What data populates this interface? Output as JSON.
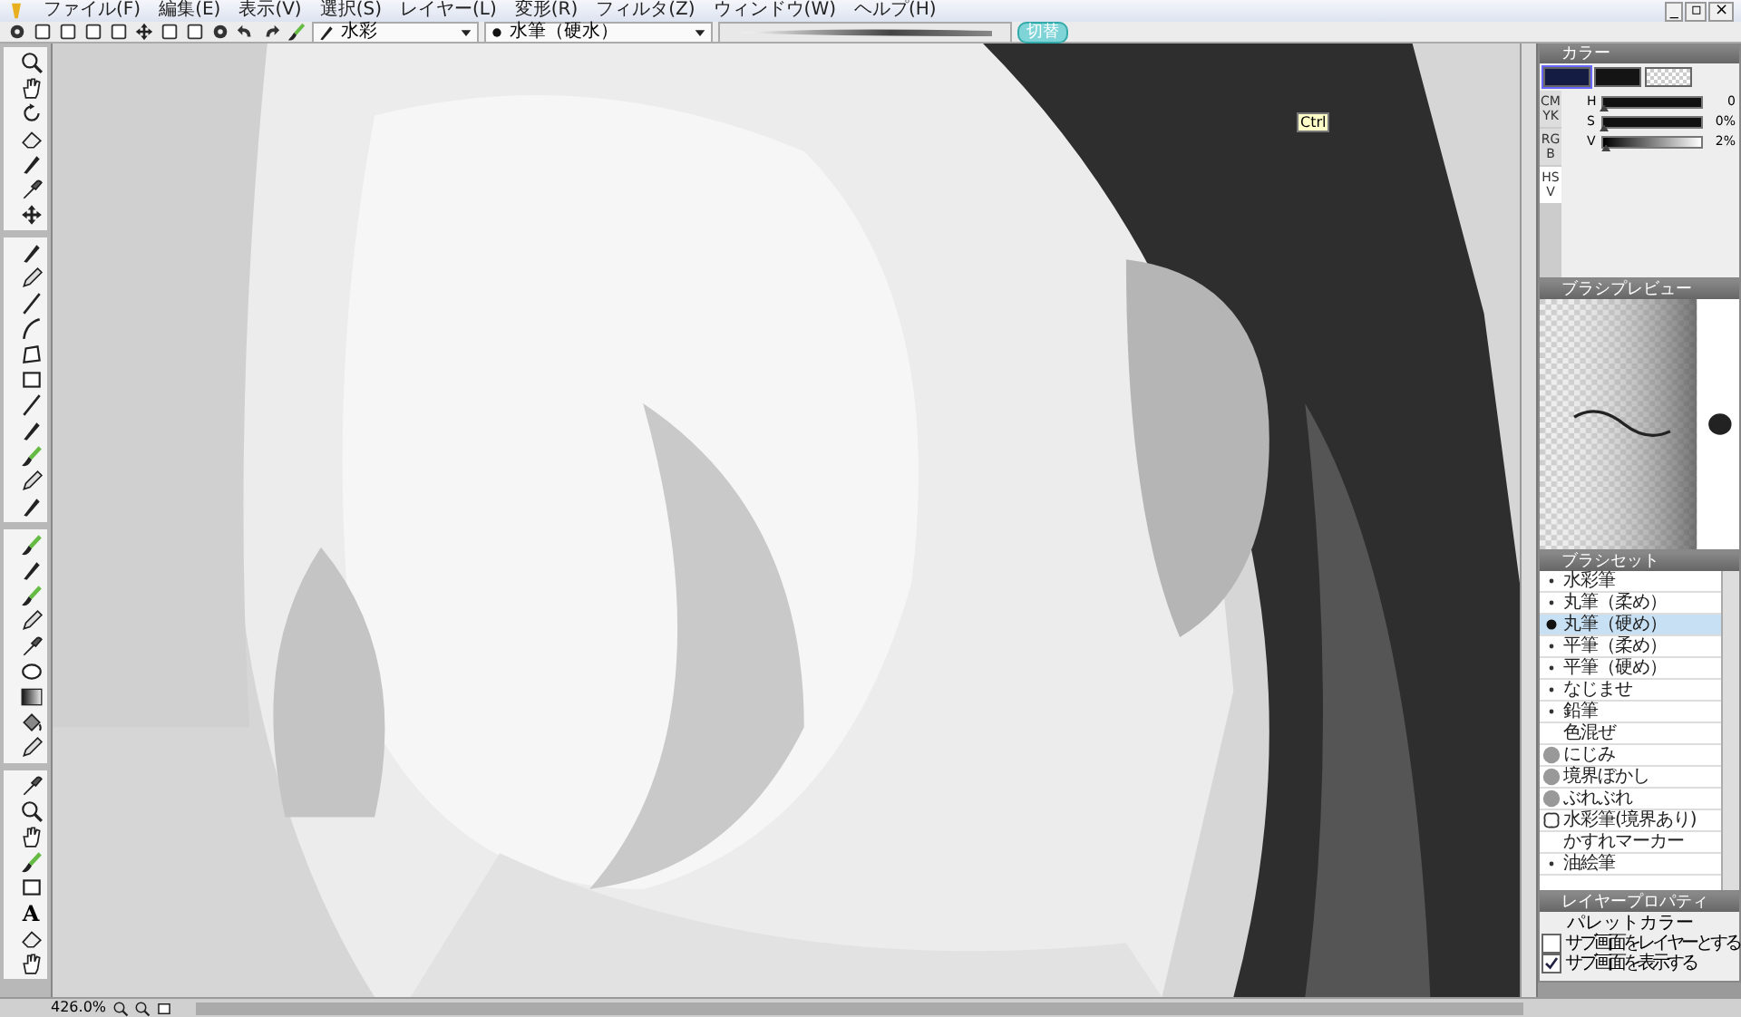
{
  "menu": [
    "ファイル(F)",
    "編集(E)",
    "表示(V)",
    "選択(S)",
    "レイヤー(L)",
    "変形(R)",
    "フィルタ(Z)",
    "ウィンドウ(W)",
    "ヘルプ(H)"
  ],
  "window_controls": [
    "_",
    "▫",
    "×"
  ],
  "toolbar": {
    "brush_category": "水彩",
    "brush": "水筆（硬水）",
    "mode_badge": "切替"
  },
  "canvas": {
    "kind": "picture",
    "tooltip": "Ctrl"
  },
  "toolbox": {
    "text_tool": "A"
  },
  "color_panel": {
    "title": "カラー",
    "tabs": [
      {
        "label": "CMYK",
        "selected": false
      },
      {
        "label": "RGB",
        "selected": false
      },
      {
        "label": "HSV",
        "selected": true
      }
    ],
    "swatches": [
      {
        "kind": "color",
        "color": "#141c44",
        "selected": true
      },
      {
        "kind": "color",
        "color": "#141414",
        "selected": false
      },
      {
        "kind": "transparent",
        "selected": false
      }
    ],
    "sliders": [
      {
        "label": "H",
        "level": 0,
        "reading": "0"
      },
      {
        "label": "S",
        "level": 0,
        "reading": "0%"
      },
      {
        "label": "V",
        "level": 0.02,
        "reading": "2%"
      }
    ]
  },
  "brush_preview": {
    "title": "ブラシプレビュー"
  },
  "brush_set": {
    "title": "ブラシセット",
    "items": [
      {
        "label": "水彩筆",
        "kind": "dot",
        "selected": false
      },
      {
        "label": "丸筆（柔め）",
        "kind": "dot",
        "selected": false
      },
      {
        "label": "丸筆（硬め）",
        "kind": "dot",
        "selected": true
      },
      {
        "label": "平筆（柔め）",
        "kind": "dot",
        "selected": false
      },
      {
        "label": "平筆（硬め）",
        "kind": "dot",
        "selected": false
      },
      {
        "label": "なじませ",
        "kind": "dot",
        "selected": false
      },
      {
        "label": "鉛筆",
        "kind": "dot",
        "selected": false
      },
      {
        "label": "色混ぜ",
        "kind": "none",
        "selected": false
      },
      {
        "label": "にじみ",
        "kind": "blob",
        "selected": false
      },
      {
        "label": "境界ぼかし",
        "kind": "blob",
        "selected": false
      },
      {
        "label": "ぶれぶれ",
        "kind": "blob",
        "selected": false
      },
      {
        "label": "水彩筆(境界あり)",
        "kind": "splat",
        "selected": false
      },
      {
        "label": "かすれマーカー",
        "kind": "none",
        "selected": false
      },
      {
        "label": "油絵筆",
        "kind": "dot",
        "selected": false
      }
    ]
  },
  "layer_properties": {
    "title": "レイヤープロパティ",
    "palette_label": "パレットカラー",
    "options": [
      {
        "label": "サブ画面をレイヤーとする",
        "checked": false
      },
      {
        "label": "サブ画面を表示する",
        "checked": true
      }
    ]
  },
  "status_bar": {
    "zoom": "426.0%"
  }
}
